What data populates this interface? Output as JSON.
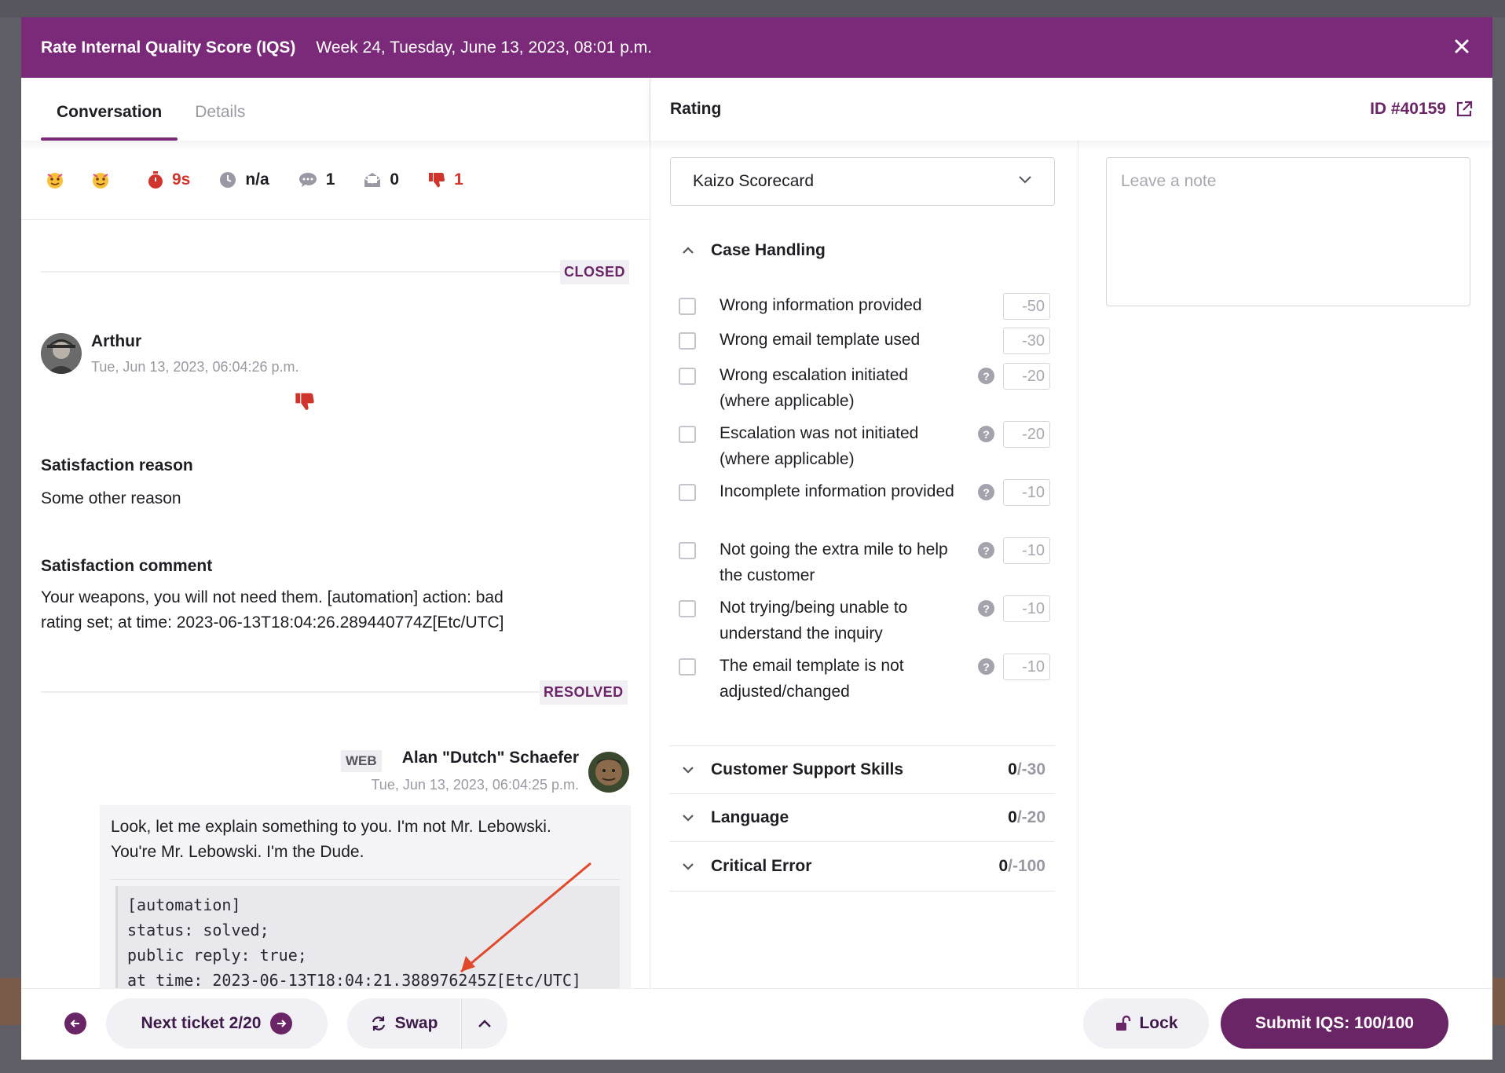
{
  "header": {
    "title": "Rate Internal Quality Score (IQS)",
    "subtitle": "Week 24, Tuesday, June 13, 2023, 08:01 p.m."
  },
  "left_tabs": [
    {
      "label": "Conversation",
      "active": true
    },
    {
      "label": "Details",
      "active": false
    }
  ],
  "stats": {
    "reply_time": "9s",
    "handle_time": "n/a",
    "comments": "1",
    "emails": "0",
    "negative": "1"
  },
  "conversation": {
    "closed_label": "CLOSED",
    "resolved_label": "RESOLVED",
    "customer": {
      "name": "Arthur",
      "timestamp": "Tue, Jun 13, 2023, 06:04:26 p.m."
    },
    "satisfaction_reason_heading": "Satisfaction reason",
    "satisfaction_reason": "Some other reason",
    "satisfaction_comment_heading": "Satisfaction comment",
    "satisfaction_comment_line1": "Your weapons, you will not need them. [automation] action: bad",
    "satisfaction_comment_line2": "rating set; at time: 2023-06-13T18:04:26.289440774Z[Etc/UTC]",
    "agent": {
      "channel": "WEB",
      "name": "Alan \"Dutch\" Schaefer",
      "timestamp": "Tue, Jun 13, 2023, 06:04:25 p.m.",
      "message_line1": "Look, let me explain something to you. I'm not Mr. Lebowski.",
      "message_line2": "You're Mr. Lebowski. I'm the Dude.",
      "code_lines": "[automation]\nstatus: solved;\npublic reply: true;\nat time: 2023-06-13T18:04:21.388976245Z[Etc/UTC]"
    }
  },
  "rating": {
    "heading": "Rating",
    "ticket_id": "ID #40159",
    "scorecard": "Kaizo Scorecard",
    "note_placeholder": "Leave a note",
    "case_handling": {
      "title": "Case Handling",
      "criteria": [
        {
          "label": "Wrong information provided",
          "points": "-50",
          "help": false
        },
        {
          "label": "Wrong email template used",
          "points": "-30",
          "help": false
        },
        {
          "label": "Wrong escalation initiated (where applicable)",
          "points": "-20",
          "help": true
        },
        {
          "label": "Escalation was not initiated (where applicable)",
          "points": "-20",
          "help": true
        },
        {
          "label": "Incomplete information provided",
          "points": "-10",
          "help": true
        },
        {
          "label": "Not going the extra mile to help the customer",
          "points": "-10",
          "help": true
        },
        {
          "label": "Not trying/being unable to understand the inquiry",
          "points": "-10",
          "help": true
        },
        {
          "label": "The email template is not adjusted/changed",
          "points": "-10",
          "help": true
        }
      ]
    },
    "categories": [
      {
        "title": "Customer Support Skills",
        "score": "0",
        "max": "/-30"
      },
      {
        "title": "Language",
        "score": "0",
        "max": "/-20"
      },
      {
        "title": "Critical Error",
        "score": "0",
        "max": "/-100"
      }
    ]
  },
  "footer": {
    "next_ticket": "Next ticket 2/20",
    "swap": "Swap",
    "lock": "Lock",
    "submit": "Submit IQS: 100/100"
  },
  "colors": {
    "brand": "#7a2a78",
    "accent_dark": "#6a2567",
    "negative": "#d0342c"
  }
}
